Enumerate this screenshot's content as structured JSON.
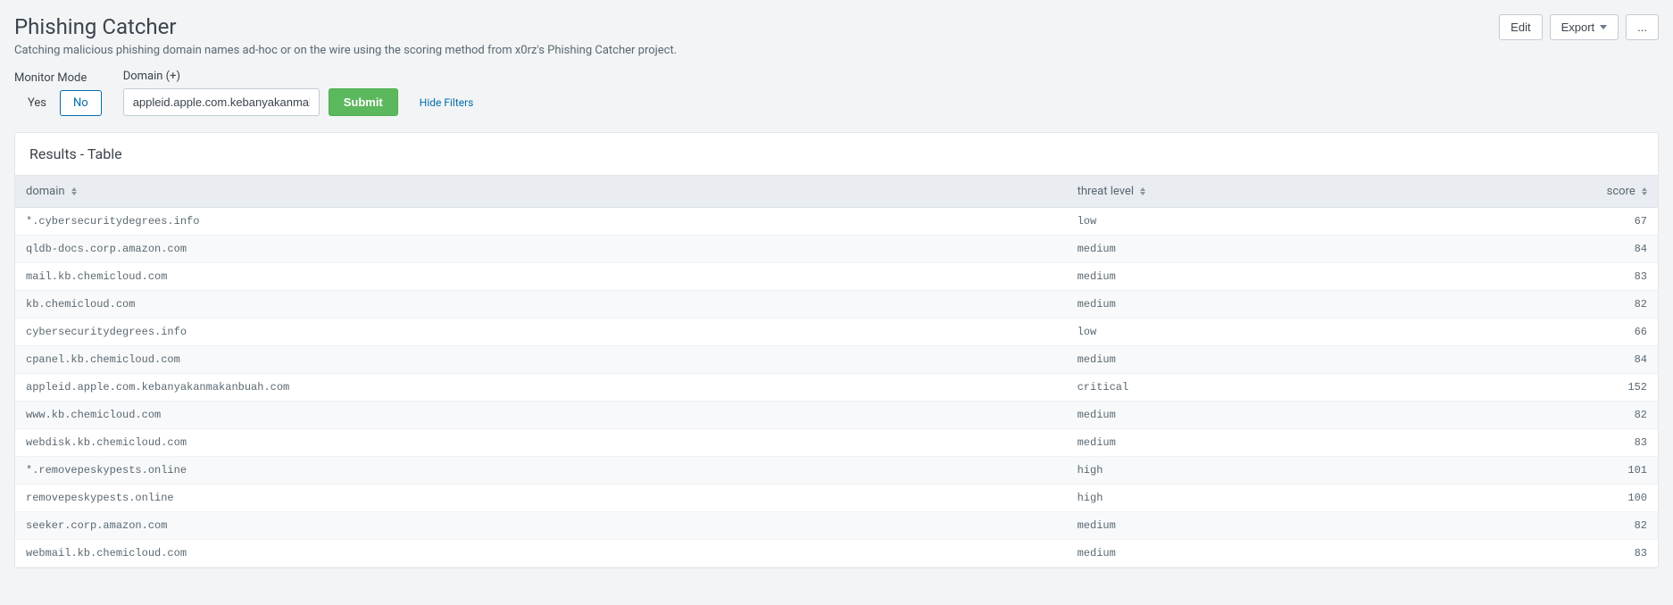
{
  "header": {
    "title": "Phishing Catcher",
    "subtitle": "Catching malicious phishing domain names ad-hoc or on the wire using the scoring method from x0rz's Phishing Catcher project.",
    "edit_label": "Edit",
    "export_label": "Export",
    "more_label": "..."
  },
  "filters": {
    "monitor_mode_label": "Monitor Mode",
    "monitor_yes": "Yes",
    "monitor_no": "No",
    "monitor_selected": "No",
    "domain_label": "Domain (+)",
    "domain_value": "appleid.apple.com.kebanyakanmakanbuah.com",
    "submit_label": "Submit",
    "hide_filters_label": "Hide Filters"
  },
  "results": {
    "panel_title": "Results - Table",
    "columns": {
      "domain": "domain",
      "threat": "threat level",
      "score": "score"
    },
    "rows": [
      {
        "domain": "*.cybersecuritydegrees.info",
        "threat": "low",
        "score": 67
      },
      {
        "domain": "qldb-docs.corp.amazon.com",
        "threat": "medium",
        "score": 84
      },
      {
        "domain": "mail.kb.chemicloud.com",
        "threat": "medium",
        "score": 83
      },
      {
        "domain": "kb.chemicloud.com",
        "threat": "medium",
        "score": 82
      },
      {
        "domain": "cybersecuritydegrees.info",
        "threat": "low",
        "score": 66
      },
      {
        "domain": "cpanel.kb.chemicloud.com",
        "threat": "medium",
        "score": 84
      },
      {
        "domain": "appleid.apple.com.kebanyakanmakanbuah.com",
        "threat": "critical",
        "score": 152
      },
      {
        "domain": "www.kb.chemicloud.com",
        "threat": "medium",
        "score": 82
      },
      {
        "domain": "webdisk.kb.chemicloud.com",
        "threat": "medium",
        "score": 83
      },
      {
        "domain": "*.removepeskypests.online",
        "threat": "high",
        "score": 101
      },
      {
        "domain": "removepeskypests.online",
        "threat": "high",
        "score": 100
      },
      {
        "domain": "seeker.corp.amazon.com",
        "threat": "medium",
        "score": 82
      },
      {
        "domain": "webmail.kb.chemicloud.com",
        "threat": "medium",
        "score": 83
      }
    ]
  }
}
